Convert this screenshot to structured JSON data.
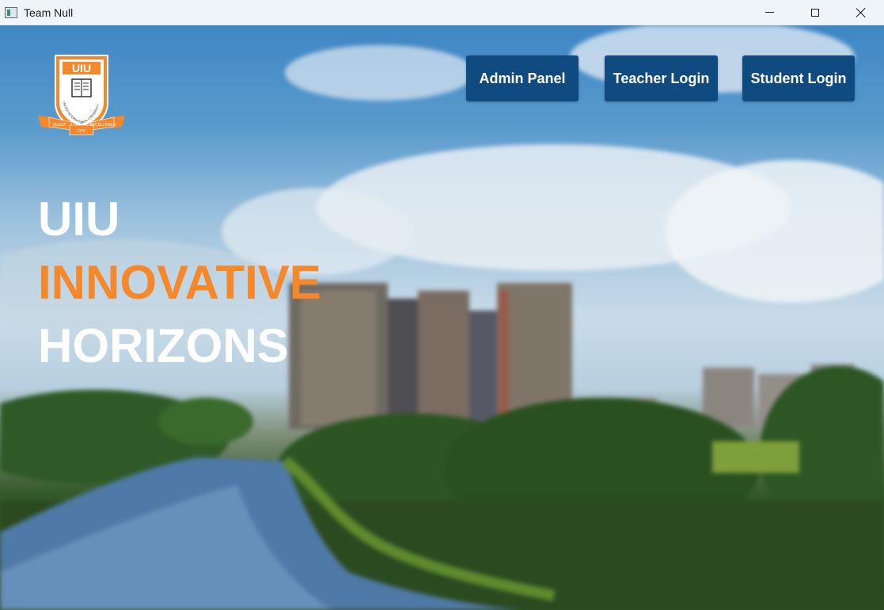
{
  "window": {
    "title": "Team Null",
    "icon": "app-window-icon",
    "controls": [
      "minimize-icon",
      "maximize-icon",
      "close-icon"
    ]
  },
  "logo": {
    "text": "UIU",
    "ribbon_left": "QUEST",
    "ribbon_center": "FOR",
    "ribbon_right": "EXCELLENCE",
    "arc_text": "UNITED INTERNATIONAL UNIVERSITY"
  },
  "nav": {
    "admin_label": "Admin Panel",
    "teacher_label": "Teacher Login",
    "student_label": "Student Login"
  },
  "hero": {
    "line1": "UIU",
    "line2": "INNOVATIVE",
    "line3": "HORIZONS"
  },
  "colors": {
    "accent_orange": "#f4882a",
    "button_blue": "#0f4a80",
    "heading_white": "#ffffff"
  }
}
